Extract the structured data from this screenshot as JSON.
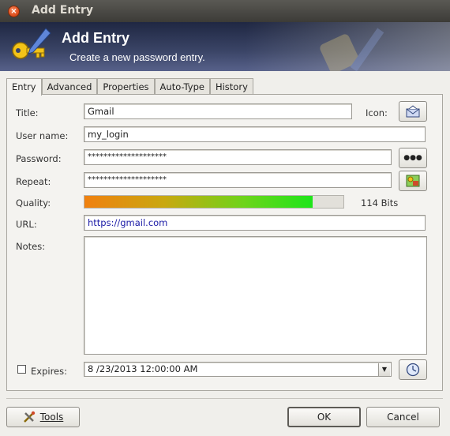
{
  "window": {
    "title": "Add Entry"
  },
  "banner": {
    "title": "Add Entry",
    "subtitle": "Create a new password entry."
  },
  "tabs": [
    {
      "label": "Entry",
      "active": true
    },
    {
      "label": "Advanced",
      "active": false
    },
    {
      "label": "Properties",
      "active": false
    },
    {
      "label": "Auto-Type",
      "active": false
    },
    {
      "label": "History",
      "active": false
    }
  ],
  "form": {
    "title_label": "Title:",
    "title_value": "Gmail",
    "icon_label": "Icon:",
    "username_label": "User name:",
    "username_value": "my_login",
    "password_label": "Password:",
    "password_value": "********************",
    "repeat_label": "Repeat:",
    "repeat_value": "********************",
    "quality_label": "Quality:",
    "quality_percent": 88,
    "quality_text": "114 Bits",
    "url_label": "URL:",
    "url_value": "https://gmail.com",
    "notes_label": "Notes:",
    "notes_value": "",
    "expires_label": "Expires:",
    "expires_checked": false,
    "expires_value": "8 /23/2013 12:00:00  AM"
  },
  "buttons": {
    "show_password": "●●●",
    "tools": "Tools",
    "ok": "OK",
    "cancel": "Cancel"
  },
  "colors": {
    "url_text": "#1a1aa6",
    "quality_start": "#f0800f",
    "quality_end": "#1ee51a"
  }
}
